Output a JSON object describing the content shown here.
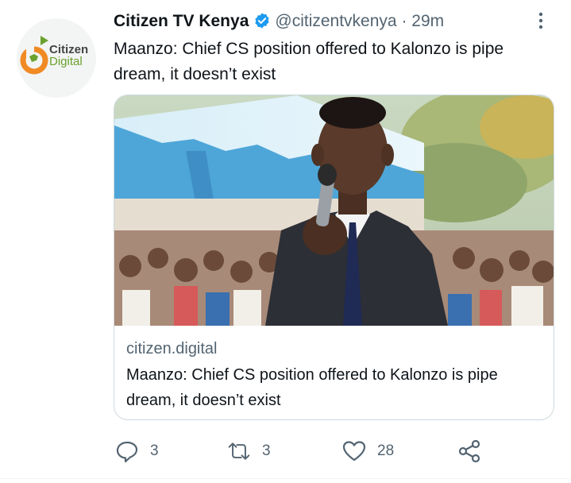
{
  "tweet": {
    "author_name": "Citizen TV Kenya",
    "handle": "@citizentvkenya",
    "separator": "·",
    "time": "29m",
    "text": "Maanzo: Chief CS position offered to Kalonzo is pipe dream, it doesn’t exist",
    "avatar_logo": {
      "line1": "Citizen",
      "line2": "Digital"
    }
  },
  "card": {
    "domain": "citizen.digital",
    "title": "Maanzo: Chief CS position offered to Kalonzo is pipe dream, it doesn’t exist"
  },
  "actions": {
    "reply_count": "3",
    "retweet_count": "3",
    "like_count": "28"
  },
  "colors": {
    "verified": "#1d9bf0",
    "secondary_text": "#536471",
    "logo_orange": "#f08a24",
    "logo_green": "#6aa22e"
  }
}
